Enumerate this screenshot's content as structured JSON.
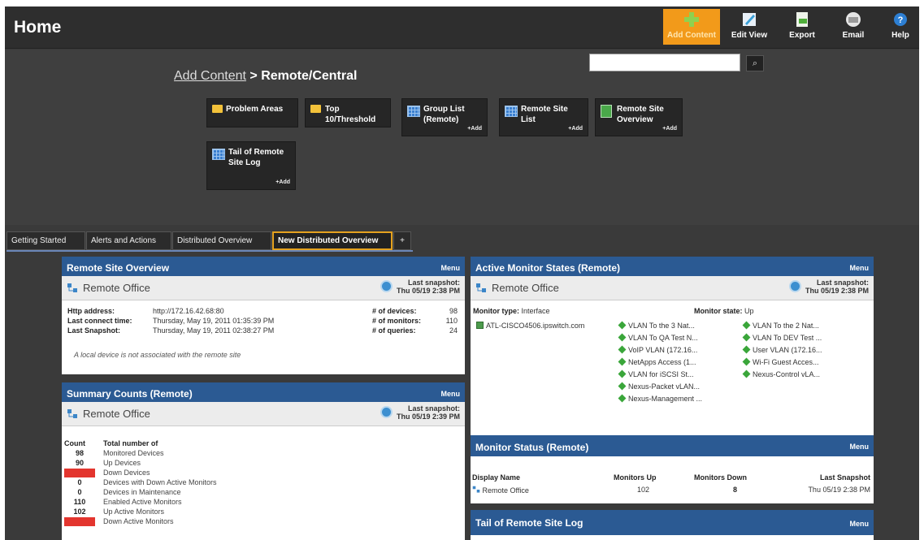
{
  "topbar": {
    "title": "Home",
    "buttons": [
      {
        "label": "Add Content",
        "icon": "add-content-icon"
      },
      {
        "label": "Edit View",
        "icon": "edit-view-icon"
      },
      {
        "label": "Export",
        "icon": "export-icon"
      },
      {
        "label": "Email",
        "icon": "email-icon"
      },
      {
        "label": "Help",
        "icon": "help-icon"
      }
    ]
  },
  "add_content": {
    "search_value": "",
    "breadcrumb_link": "Add Content",
    "breadcrumb_sep": " > ",
    "breadcrumb_current": "Remote/Central",
    "tiles": [
      {
        "label": "Problem Areas",
        "icon": "folder-icon",
        "add": ""
      },
      {
        "label": "Top 10/Threshold",
        "icon": "folder-icon",
        "add": ""
      },
      {
        "label": "Group List (Remote)",
        "icon": "grid-icon",
        "add": "+Add"
      },
      {
        "label": "Remote Site List",
        "icon": "grid-icon",
        "add": "+Add"
      },
      {
        "label": "Remote Site Overview",
        "icon": "overview-icon",
        "add": "+Add"
      },
      {
        "label": "Tail of Remote Site Log",
        "icon": "grid-icon",
        "add": "+Add"
      }
    ]
  },
  "tabs": [
    {
      "label": "Getting Started"
    },
    {
      "label": "Alerts and Actions"
    },
    {
      "label": "Distributed Overview"
    },
    {
      "label": "New Distributed Overview"
    },
    {
      "label": "+"
    }
  ],
  "remote_site_overview": {
    "title": "Remote Site Overview",
    "menu": "Menu",
    "office": "Remote Office",
    "snap_label": "Last snapshot:",
    "snap_time": "Thu 05/19 2:38 PM",
    "http_label": "Http address:",
    "http_value": "http://172.16.42.68:80",
    "lc_label": "Last connect time:",
    "lc_value": "Thursday, May 19, 2011 01:35:39 PM",
    "ls_label": "Last Snapshot:",
    "ls_value": "Thursday, May 19, 2011 02:38:27 PM",
    "dev_label": "# of devices:",
    "dev_value": "98",
    "mon_label": "# of monitors:",
    "mon_value": "110",
    "q_label": "# of queries:",
    "q_value": "24",
    "note": "A local device is not associated with the remote site"
  },
  "summary_counts": {
    "title": "Summary Counts (Remote)",
    "menu": "Menu",
    "office": "Remote Office",
    "snap_label": "Last snapshot:",
    "snap_time": "Thu 05/19 2:39 PM",
    "col_count": "Count",
    "col_total": "Total number of",
    "rows": [
      {
        "count": "98",
        "label": "Monitored Devices",
        "alert": false
      },
      {
        "count": "90",
        "label": "Up Devices",
        "alert": false
      },
      {
        "count": "8",
        "label": "Down Devices",
        "alert": true
      },
      {
        "count": "0",
        "label": "Devices with Down Active Monitors",
        "alert": false
      },
      {
        "count": "0",
        "label": "Devices in Maintenance",
        "alert": false
      },
      {
        "count": "110",
        "label": "Enabled Active Monitors",
        "alert": false
      },
      {
        "count": "102",
        "label": "Up Active Monitors",
        "alert": false
      },
      {
        "count": "8",
        "label": "Down Active Monitors",
        "alert": true
      }
    ]
  },
  "active_monitor_states": {
    "title": "Active Monitor States (Remote)",
    "menu": "Menu",
    "office": "Remote Office",
    "snap_label": "Last snapshot:",
    "snap_time": "Thu 05/19 2:38 PM",
    "type_label": "Monitor type:",
    "type_value": "Interface",
    "state_label": "Monitor state:",
    "state_value": "Up",
    "device": "ATL-CISCO4506.ipswitch.com",
    "col1": [
      "VLAN To the 3 Nat...",
      "VLAN To QA Test N...",
      "VoIP VLAN (172.16...",
      "NetApps Access (1...",
      "VLAN for iSCSI St...",
      "Nexus-Packet vLAN...",
      "Nexus-Management ..."
    ],
    "col2": [
      "VLAN To the 2 Nat...",
      "VLAN To DEV Test ...",
      "User VLAN (172.16...",
      "Wi-Fi Guest Acces...",
      "Nexus-Control vLA..."
    ]
  },
  "monitor_status": {
    "title": "Monitor Status (Remote)",
    "menu": "Menu",
    "headers": [
      "Display Name",
      "Monitors Up",
      "Monitors Down",
      "Last Snapshot"
    ],
    "row": {
      "name": "Remote Office",
      "up": "102",
      "down": "8",
      "snap": "Thu 05/19 2:38 PM"
    }
  },
  "tail_log": {
    "title": "Tail of Remote Site Log",
    "menu": "Menu"
  }
}
